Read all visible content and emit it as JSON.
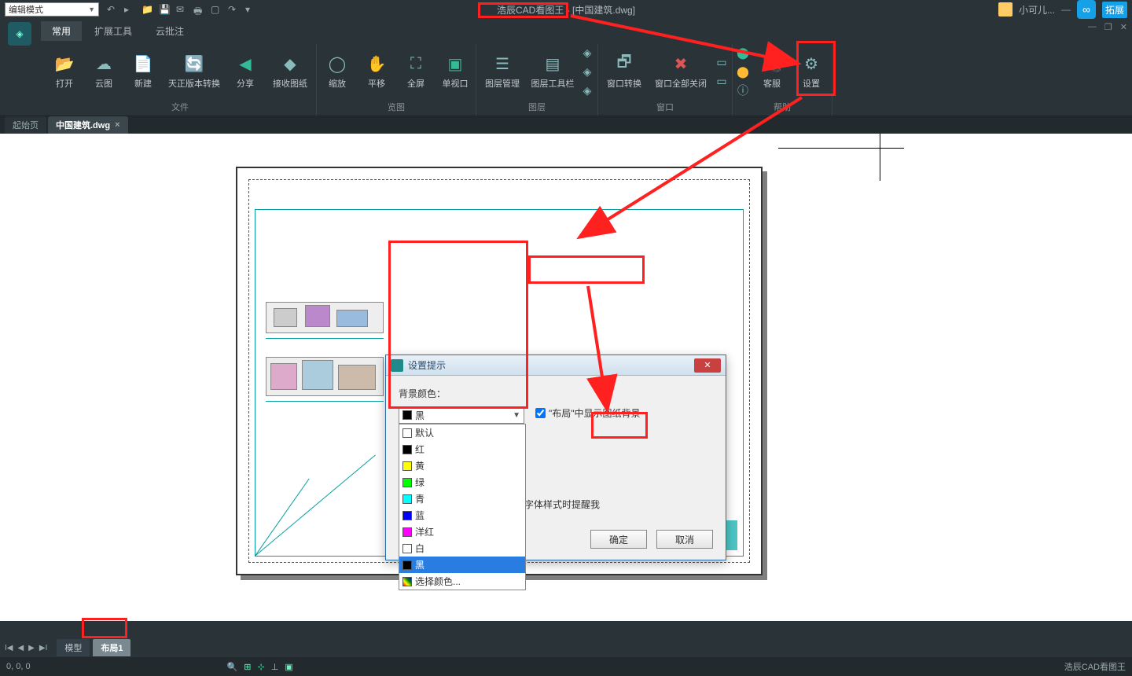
{
  "titlebar": {
    "mode": "编辑模式",
    "app_title": "浩辰CAD看图王 - [中国建筑.dwg]",
    "username": "小可儿...",
    "tuozhan": "拓展"
  },
  "menutabs": {
    "common": "常用",
    "extend": "扩展工具",
    "cloud": "云批注"
  },
  "ribbon": {
    "open": "打开",
    "cloud": "云图",
    "new": "新建",
    "tianzheng": "天正版本转换",
    "share": "分享",
    "receive": "接收图纸",
    "zoom": "缩放",
    "pan": "平移",
    "full": "全屏",
    "viewport": "单视口",
    "layermgr": "图层管理",
    "layertoolbar": "图层工具栏",
    "winswitch": "窗口转换",
    "wincloseall": "窗口全部关闭",
    "support": "客服",
    "settings": "设置",
    "g_file": "文件",
    "g_view": "览图",
    "g_layer": "图层",
    "g_window": "窗口",
    "g_help": "帮助"
  },
  "doctabs": {
    "start": "起始页",
    "file": "中国建筑.dwg"
  },
  "modal": {
    "title": "设置提示",
    "bg_label": "背景颜色：",
    "selected": "黑",
    "options": {
      "default": "默认",
      "red": "红",
      "yellow": "黄",
      "green": "绿",
      "cyan": "青",
      "blue": "蓝",
      "magenta": "洋红",
      "white": "白",
      "black": "黑",
      "choose": "选择颜色..."
    },
    "checkbox_label": "\"布局\"中显示图纸背景",
    "partial_text": "字体样式时提醒我",
    "ok": "确定",
    "cancel": "取消"
  },
  "layouts": {
    "model": "模型",
    "layout1": "布局1"
  },
  "status": {
    "coords": "0, 0, 0",
    "brand": "浩辰CAD看图王"
  },
  "colors": {
    "black": "#000000",
    "red": "#ff0000",
    "yellow": "#ffff00",
    "green": "#00ff00",
    "cyan": "#00ffff",
    "blue": "#0000ff",
    "magenta": "#ff00ff",
    "white": "#ffffff"
  }
}
